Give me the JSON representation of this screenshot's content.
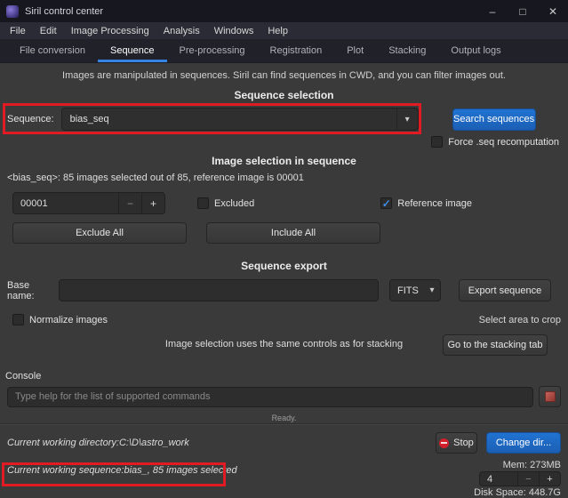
{
  "window": {
    "title": "Siril control center",
    "minimize": "–",
    "maximize": "□",
    "close": "✕"
  },
  "menubar": {
    "items": [
      "File",
      "Edit",
      "Image Processing",
      "Analysis",
      "Windows",
      "Help"
    ]
  },
  "tabs": {
    "items": [
      {
        "label": "File conversion"
      },
      {
        "label": "Sequence"
      },
      {
        "label": "Pre-processing"
      },
      {
        "label": "Registration"
      },
      {
        "label": "Plot"
      },
      {
        "label": "Stacking"
      },
      {
        "label": "Output logs"
      }
    ]
  },
  "icons": {
    "dropdown": "▾",
    "minus": "−",
    "plus": "+",
    "check": "✓"
  },
  "sequence": {
    "intro": "Images are manipulated in sequences. Siril can find sequences in CWD, and you can filter images out.",
    "selection_heading": "Sequence selection",
    "label": "Sequence:",
    "value": "bias_seq",
    "search_button": "Search sequences",
    "force_recompute_label": "Force .seq recomputation",
    "image_selection_heading": "Image selection in sequence",
    "selection_info": "<bias_seq>: 85 images selected out of 85, reference image is 00001",
    "image_number": "00001",
    "excluded_label": "Excluded",
    "reference_label": "Reference image",
    "exclude_all_button": "Exclude All",
    "include_all_button": "Include All",
    "export_heading": "Sequence export",
    "base_name_label": "Base name:",
    "base_name_value": "",
    "format_value": "FITS",
    "export_button": "Export sequence",
    "normalize_label": "Normalize images",
    "crop_label": "Select area to crop",
    "stacking_note": "Image selection uses the same controls as for stacking",
    "stacking_button": "Go to the stacking tab"
  },
  "console": {
    "label": "Console",
    "placeholder": "Type help for the list of supported commands",
    "status": "Ready.",
    "cwd_label": "Current working directory:",
    "cwd_value": "C:\\D\\astro_work",
    "stop_button": "Stop",
    "change_dir_button": "Change dir...",
    "cws_label": "Current working sequence:",
    "cws_value": "bias_, 85 images selected",
    "mem": "Mem: 273MB",
    "disk": "Disk Space: 448.7G",
    "threads": "4"
  }
}
